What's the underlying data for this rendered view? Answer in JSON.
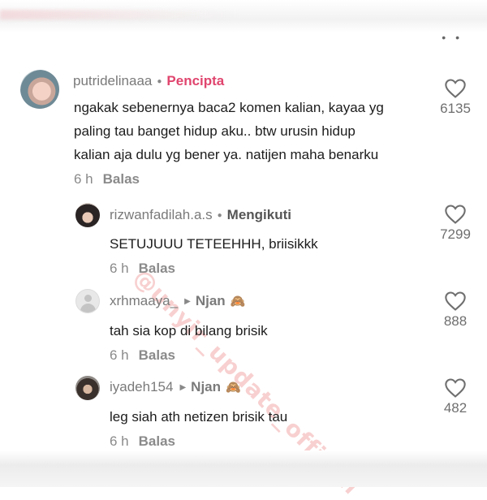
{
  "top_menu_icon": "more-dots-icon",
  "watermark": "@unyir_update_official",
  "main_comment": {
    "username": "putridelinaaa",
    "badge": "Pencipta",
    "text_lines": [
      "ngakak sebenernya baca2 komen kalian, kayaa yg",
      "paling tau banget hidup aku.. btw urusin hidup",
      "kalian aja dulu yg bener ya. natijen maha benarku"
    ],
    "time": "6 h",
    "reply_label": "Balas",
    "likes": "6135"
  },
  "replies": [
    {
      "username": "rizwanfadilah.a.s",
      "badge": "Mengikuti",
      "text": "SETUJUUU TETEEHHH, briisikkk",
      "time": "6 h",
      "reply_label": "Balas",
      "likes": "7299"
    },
    {
      "username": "xrhmaaya_",
      "reply_to": "Njan",
      "emoji": "🙈",
      "text": "tah sia kop di bilang brisik",
      "time": "6 h",
      "reply_label": "Balas",
      "likes": "888"
    },
    {
      "username": "iyadeh154",
      "reply_to": "Njan",
      "emoji": "🙈",
      "text": "leg siah ath netizen brisik tau",
      "time": "6 h",
      "reply_label": "Balas",
      "likes": "482"
    }
  ],
  "colors": {
    "creator_badge": "#e0456e",
    "username": "#7a7a7a",
    "text": "#1c1c1c",
    "meta": "#8a8a8a"
  }
}
